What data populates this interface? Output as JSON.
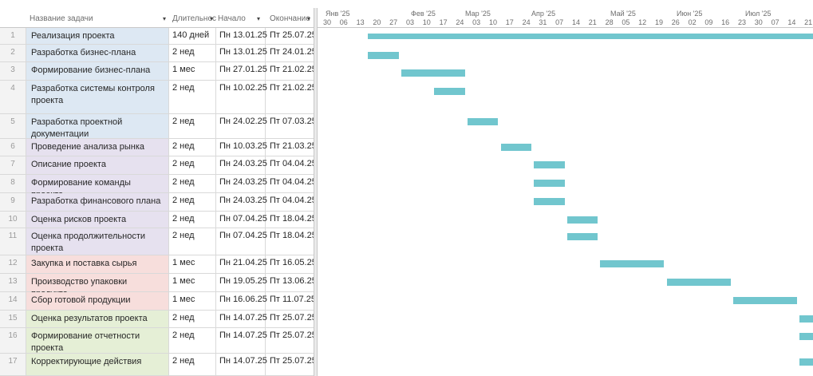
{
  "columns": {
    "name": "Название задачи",
    "duration": "Длительнос",
    "start": "Начало",
    "end": "Окончание"
  },
  "timeline": {
    "months": [
      "Янв '25",
      "Фев '25",
      "Мар '25",
      "Апр '25",
      "Май '25",
      "Июн '25",
      "Июл '25"
    ],
    "weeks": [
      "30",
      "06",
      "13",
      "20",
      "27",
      "03",
      "10",
      "17",
      "24",
      "03",
      "10",
      "17",
      "24",
      "31",
      "07",
      "14",
      "21",
      "28",
      "05",
      "12",
      "19",
      "26",
      "02",
      "09",
      "16",
      "23",
      "30",
      "07",
      "14",
      "21"
    ]
  },
  "tasks": [
    {
      "id": "1",
      "name": "Реализация проекта",
      "duration": "140 дней",
      "start": "Пн 13.01.25",
      "end": "Пт 25.07.25",
      "bar_start_week": 2,
      "bar_weeks": 28,
      "summary": true
    },
    {
      "id": "2",
      "name": "Разработка бизнес-плана проекта",
      "duration": "2 нед",
      "start": "Пн 13.01.25",
      "end": "Пт 24.01.25",
      "bar_start_week": 2,
      "bar_weeks": 2
    },
    {
      "id": "3",
      "name": "Формирование бизнес-плана",
      "duration": "1 мес",
      "start": "Пн 27.01.25",
      "end": "Пт 21.02.25",
      "bar_start_week": 4,
      "bar_weeks": 4
    },
    {
      "id": "4",
      "name": "Разработка системы контроля проекта",
      "duration": "2 нед",
      "start": "Пн 10.02.25",
      "end": "Пт 21.02.25",
      "bar_start_week": 6,
      "bar_weeks": 2
    },
    {
      "id": "5",
      "name": "Разработка проектной документации",
      "duration": "2 нед",
      "start": "Пн 24.02.25",
      "end": "Пт 07.03.25",
      "bar_start_week": 8,
      "bar_weeks": 2
    },
    {
      "id": "6",
      "name": "Проведение анализа рынка",
      "duration": "2 нед",
      "start": "Пн 10.03.25",
      "end": "Пт 21.03.25",
      "bar_start_week": 10,
      "bar_weeks": 2
    },
    {
      "id": "7",
      "name": "Описание проекта",
      "duration": "2 нед",
      "start": "Пн 24.03.25",
      "end": "Пт 04.04.25",
      "bar_start_week": 12,
      "bar_weeks": 2
    },
    {
      "id": "8",
      "name": "Формирование команды проекта",
      "duration": "2 нед",
      "start": "Пн 24.03.25",
      "end": "Пт 04.04.25",
      "bar_start_week": 12,
      "bar_weeks": 2
    },
    {
      "id": "9",
      "name": "Разработка финансового плана",
      "duration": "2 нед",
      "start": "Пн 24.03.25",
      "end": "Пт 04.04.25",
      "bar_start_week": 12,
      "bar_weeks": 2
    },
    {
      "id": "10",
      "name": "Оценка рисков проекта",
      "duration": "2 нед",
      "start": "Пн 07.04.25",
      "end": "Пт 18.04.25",
      "bar_start_week": 14,
      "bar_weeks": 2
    },
    {
      "id": "11",
      "name": "Оценка продолжительности проекта",
      "duration": "2 нед",
      "start": "Пн 07.04.25",
      "end": "Пт 18.04.25",
      "bar_start_week": 14,
      "bar_weeks": 2
    },
    {
      "id": "12",
      "name": "Закупка и поставка сырья",
      "duration": "1 мес",
      "start": "Пн 21.04.25",
      "end": "Пт 16.05.25",
      "bar_start_week": 16,
      "bar_weeks": 4
    },
    {
      "id": "13",
      "name": "Производство упаковки продукта",
      "duration": "1 мес",
      "start": "Пн 19.05.25",
      "end": "Пт 13.06.25",
      "bar_start_week": 20,
      "bar_weeks": 4
    },
    {
      "id": "14",
      "name": "Сбор готовой продукции",
      "duration": "1 мес",
      "start": "Пн 16.06.25",
      "end": "Пт 11.07.25",
      "bar_start_week": 24,
      "bar_weeks": 4
    },
    {
      "id": "15",
      "name": "Оценка результатов проекта",
      "duration": "2 нед",
      "start": "Пн 14.07.25",
      "end": "Пт 25.07.25",
      "bar_start_week": 28,
      "bar_weeks": 2
    },
    {
      "id": "16",
      "name": "Формирование отчетности проекта",
      "duration": "2 нед",
      "start": "Пн 14.07.25",
      "end": "Пт 25.07.25",
      "bar_start_week": 28,
      "bar_weeks": 2
    },
    {
      "id": "17",
      "name": "Корректирующие действия",
      "duration": "2 нед",
      "start": "Пн 14.07.25",
      "end": "Пт 25.07.25",
      "bar_start_week": 28,
      "bar_weeks": 2
    }
  ],
  "colors": {
    "bar": "#71c6ce",
    "phase_initiation": "#dde8f3",
    "phase_planning": "#e6e1ef",
    "phase_execution": "#f7dedc",
    "phase_closing": "#e5efd6"
  },
  "icons": {
    "column_dropdown": "chevron-down-icon"
  }
}
